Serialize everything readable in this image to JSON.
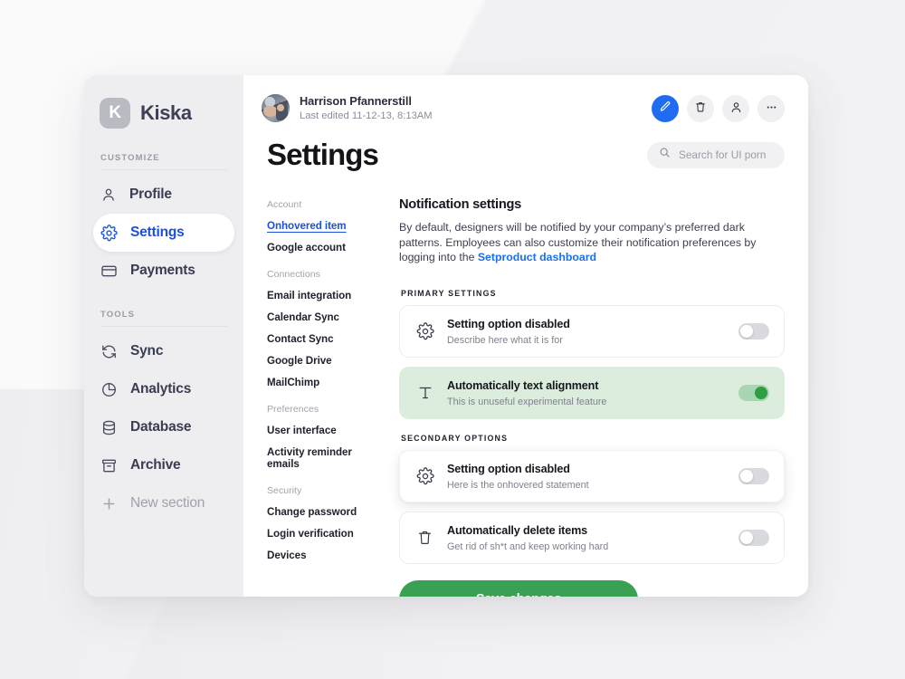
{
  "brand": {
    "mark": "K",
    "name": "Kiska",
    "mark_color": "#b9bac2"
  },
  "sidebar": {
    "groups": [
      {
        "label": "CUSTOMIZE",
        "items": [
          {
            "label": "Profile",
            "icon": "user-icon",
            "active": false
          },
          {
            "label": "Settings",
            "icon": "gear-icon",
            "active": true
          },
          {
            "label": "Payments",
            "icon": "card-icon",
            "active": false
          }
        ]
      },
      {
        "label": "TOOLS",
        "items": [
          {
            "label": "Sync",
            "icon": "sync-icon",
            "active": false
          },
          {
            "label": "Analytics",
            "icon": "pie-chart-icon",
            "active": false
          },
          {
            "label": "Database",
            "icon": "database-icon",
            "active": false
          },
          {
            "label": "Archive",
            "icon": "archive-icon",
            "active": false
          },
          {
            "label": "New section",
            "icon": "plus-icon",
            "active": false,
            "muted": true
          }
        ]
      }
    ]
  },
  "topbar": {
    "user_name": "Harrison Pfannerstill",
    "last_edited": "Last edited 11-12-13, 8:13AM",
    "avatar": "user-photo-avatar",
    "actions": [
      {
        "name": "edit-button",
        "icon": "pencil-icon",
        "primary": true
      },
      {
        "name": "delete-button",
        "icon": "trash-icon",
        "primary": false
      },
      {
        "name": "account-button",
        "icon": "person-icon",
        "primary": false
      },
      {
        "name": "more-button",
        "icon": "ellipsis-icon",
        "primary": false
      }
    ]
  },
  "page": {
    "title": "Settings"
  },
  "search": {
    "placeholder": "Search for UI porn",
    "value": "",
    "icon": "search-icon"
  },
  "subnav": {
    "groups": [
      {
        "label": "Account",
        "items": [
          {
            "label": "Onhovered item",
            "state": "hovered"
          },
          {
            "label": "Google account",
            "state": "default"
          }
        ]
      },
      {
        "label": "Connections",
        "items": [
          {
            "label": "Email integration",
            "state": "default"
          },
          {
            "label": "Calendar Sync",
            "state": "default"
          },
          {
            "label": "Contact Sync",
            "state": "default"
          },
          {
            "label": "Google Drive",
            "state": "default"
          },
          {
            "label": "MailChimp",
            "state": "default"
          }
        ]
      },
      {
        "label": "Preferences",
        "items": [
          {
            "label": "User interface",
            "state": "default"
          },
          {
            "label": "Activity reminder emails",
            "state": "default"
          }
        ]
      },
      {
        "label": "Security",
        "items": [
          {
            "label": "Change password",
            "state": "default"
          },
          {
            "label": "Login verification",
            "state": "default"
          },
          {
            "label": "Devices",
            "state": "default"
          }
        ]
      }
    ]
  },
  "panel": {
    "title": "Notification settings",
    "description_part1": "By default, designers will be notified by your company’s preferred dark patterns. Employees can also customize their notification preferences by logging into the ",
    "description_link": "Setproduct dashboard",
    "primary_label": "PRIMARY SETTINGS",
    "secondary_label": "SECONDARY OPTIONS",
    "primary_settings": [
      {
        "icon": "gear-icon",
        "title": "Setting option disabled",
        "subtitle": "Describe here what it is for",
        "toggle_on": false,
        "highlighted": false,
        "elevated": false
      },
      {
        "icon": "text-format-icon",
        "title": "Automatically text alignment",
        "subtitle": "This is unuseful experimental feature",
        "toggle_on": true,
        "highlighted": true,
        "elevated": false
      }
    ],
    "secondary_settings": [
      {
        "icon": "gear-icon",
        "title": "Setting option disabled",
        "subtitle": "Here is the onhovered statement",
        "toggle_on": false,
        "highlighted": false,
        "elevated": true
      },
      {
        "icon": "trash-icon",
        "title": "Automatically delete items",
        "subtitle": "Get rid of sh*t and keep working hard",
        "toggle_on": false,
        "highlighted": false,
        "elevated": false
      }
    ],
    "save_label": "Save changes"
  },
  "colors": {
    "accent_blue": "#1a50dd",
    "primary_blue": "#1f6cf0",
    "save_green": "#3aa054",
    "toggle_on_green": "#2e9e43",
    "highlight_green_bg": "#dcedde",
    "sidebar_bg": "#eeeef1",
    "page_bg": "#f4f4f6"
  }
}
